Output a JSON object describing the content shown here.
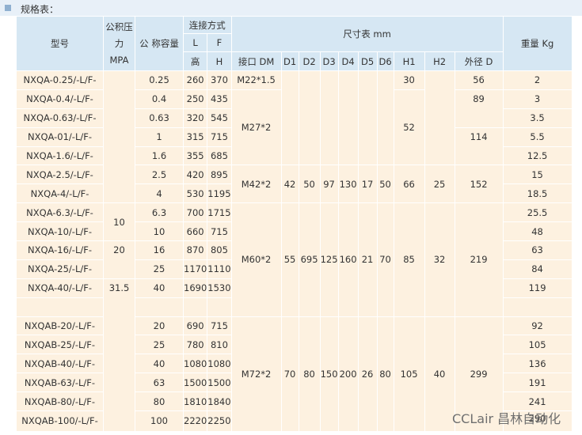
{
  "title": "规格表：",
  "header": {
    "model": "型号",
    "pressure_line1": "公积压",
    "pressure_line2": "力",
    "pressure_unit": "MPA",
    "volume": "公 称容量",
    "connect": "连接方式",
    "l": "L",
    "f": "F",
    "height": "高",
    "h": "H",
    "dims": "尺寸表 mm",
    "dm": "接口 DM",
    "d1": "D1",
    "d2": "D2",
    "d3": "D3",
    "d4": "D4",
    "d5": "D5",
    "d6": "D6",
    "h1": "H1",
    "h2": "H2",
    "od": "外径 D",
    "weight": "重量 Kg"
  },
  "rows": [
    {
      "model": "NXQA-0.25/-L/F-",
      "vol": "0.25",
      "l": "260",
      "f": "370",
      "weight": "2"
    },
    {
      "model": "NXQA-0.4/-L/F-",
      "vol": "0.4",
      "l": "250",
      "f": "435",
      "weight": "3"
    },
    {
      "model": "NXQA-0.63/-L/F-",
      "vol": "0.63",
      "l": "320",
      "f": "545",
      "weight": "3.5"
    },
    {
      "model": "NXQA-01/-L/F-",
      "vol": "1",
      "l": "315",
      "f": "715",
      "weight": "5.5"
    },
    {
      "model": "NXQA-1.6/-L/F-",
      "vol": "1.6",
      "l": "355",
      "f": "685",
      "weight": "12.5"
    },
    {
      "model": "NXQA-2.5/-L/F-",
      "vol": "2.5",
      "l": "420",
      "f": "895",
      "weight": "15"
    },
    {
      "model": "NXQA-4/-L/F-",
      "vol": "4",
      "l": "530",
      "f": "1195",
      "weight": "18.5"
    },
    {
      "model": "NXQA-6.3/-L/F-",
      "vol": "6.3",
      "l": "700",
      "f": "1715",
      "weight": "25.5"
    },
    {
      "model": "NXQA-10/-L/F-",
      "vol": "10",
      "l": "660",
      "f": "715",
      "weight": "48"
    },
    {
      "model": "NXQA-16/-L/F-",
      "vol": "16",
      "l": "870",
      "f": "805",
      "weight": "63"
    },
    {
      "model": "NXQA-25/-L/F-",
      "vol": "25",
      "l": "1170",
      "f": "1110",
      "weight": "84"
    },
    {
      "model": "NXQA-40/-L/F-",
      "vol": "40",
      "l": "1690",
      "f": "1530",
      "weight": "119"
    },
    {
      "model": "",
      "vol": "",
      "l": "",
      "f": "",
      "weight": ""
    },
    {
      "model": "NXQAB-20/-L/F-",
      "vol": "20",
      "l": "690",
      "f": "715",
      "weight": "92"
    },
    {
      "model": "NXQAB-25/-L/F-",
      "vol": "25",
      "l": "780",
      "f": "810",
      "weight": "105"
    },
    {
      "model": "NXQAB-40/-L/F-",
      "vol": "40",
      "l": "1080",
      "f": "1080",
      "weight": "136"
    },
    {
      "model": "NXQAB-63/-L/F-",
      "vol": "63",
      "l": "1500",
      "f": "1500",
      "weight": "191"
    },
    {
      "model": "NXQAB-80/-L/F-",
      "vol": "80",
      "l": "1810",
      "f": "1840",
      "weight": "241"
    },
    {
      "model": "NXQAB-100/-L/F-",
      "vol": "100",
      "l": "2220",
      "f": "2250",
      "weight": "290"
    }
  ],
  "pressure": {
    "p1": "10",
    "p2": "20",
    "p3": "31.5"
  },
  "groups": {
    "g1": {
      "dm": "M22*1.5",
      "h1": "30",
      "od": "56"
    },
    "g2": {
      "dm": "M27*2",
      "h1": "52",
      "od1": "89",
      "od2": "114"
    },
    "g3": {
      "dm": "M42*2",
      "d1": "42",
      "d2": "50",
      "d3": "97",
      "d4": "130",
      "d5": "17",
      "d6": "50",
      "h1": "66",
      "h2": "25",
      "od": "152"
    },
    "g4": {
      "dm": "M60*2",
      "d1": "55",
      "d2": "695",
      "d3": "125",
      "d4": "160",
      "d5": "21",
      "d6": "70",
      "h1": "85",
      "h2": "32",
      "od": "219"
    },
    "g5": {
      "dm": "M72*2",
      "d1": "70",
      "d2": "80",
      "d3": "150",
      "d4": "200",
      "d5": "26",
      "d6": "80",
      "h1": "105",
      "h2": "40",
      "od": "299"
    }
  },
  "watermark": "CCLair 昌林自动化",
  "colors": {
    "header_bg": "#d6e7f3",
    "body_bg": "#fdf1e0",
    "title_bg": "#e8f0f8"
  }
}
